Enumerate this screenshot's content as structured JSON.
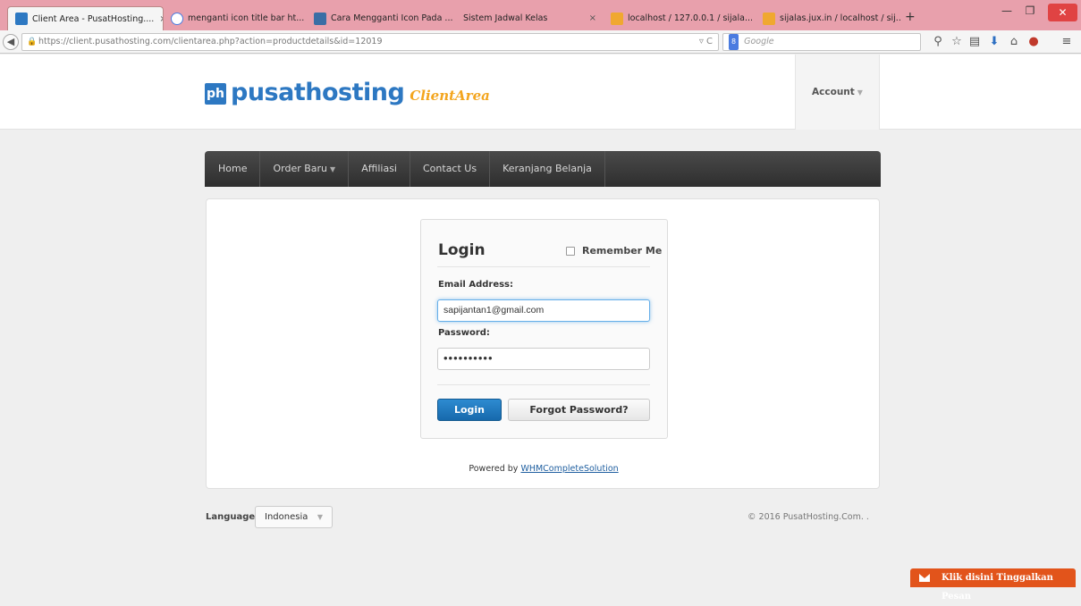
{
  "browser": {
    "tabs": [
      {
        "title": "Client Area - PusatHosting....",
        "active": true,
        "close": "×"
      },
      {
        "title": "menganti icon title bar ht...",
        "close": "×"
      },
      {
        "title": "Cara Mengganti Icon Pada ...",
        "close": "×"
      },
      {
        "title": "Sistem Jadwal Kelas",
        "close": "×"
      },
      {
        "title": "localhost / 127.0.0.1 / sijala...",
        "close": "×"
      },
      {
        "title": "sijalas.jux.in / localhost / sij...",
        "close": "×"
      }
    ],
    "new_tab": "+",
    "url": "https://client.pusathosting.com/clientarea.php?action=productdetails&id=12019",
    "search_placeholder": "Google",
    "search_engine": "8"
  },
  "header": {
    "logo_badge": "ph",
    "logo_text": "pusathosting",
    "logo_sub": "ClientArea",
    "account_label": "Account"
  },
  "nav": {
    "items": [
      "Home",
      "Order Baru",
      "Affiliasi",
      "Contact Us",
      "Keranjang Belanja"
    ]
  },
  "login": {
    "title": "Login",
    "remember_me": "Remember Me",
    "email_label": "Email Address:",
    "email_value": "sapijantan1@gmail.com",
    "password_label": "Password:",
    "password_value": "••••••••••",
    "login_button": "Login",
    "forgot_button": "Forgot Password?"
  },
  "footer": {
    "powered_prefix": "Powered by",
    "powered_link": "WHMCompleteSolution",
    "language_label": "Language:",
    "language_value": "Indonesia",
    "copyright": "© 2016 PusatHosting.Com. ."
  },
  "livechat": {
    "label": "Klik disini Tinggalkan Pesan"
  },
  "colors": {
    "brand": "#2d78c2",
    "accent": "#f3a51e",
    "primary_button": "#1769ac",
    "livechat": "#e2541b"
  }
}
